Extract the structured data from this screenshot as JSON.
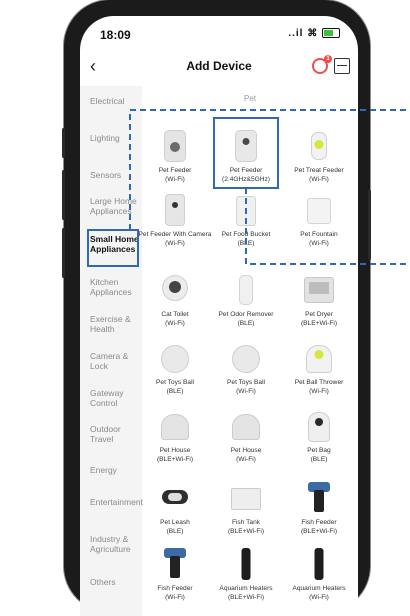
{
  "status": {
    "time": "18:09",
    "signal": "..il"
  },
  "header": {
    "title": "Add Device",
    "badge": "1"
  },
  "section": {
    "label": "Pet"
  },
  "sidebar": {
    "items": [
      {
        "label": "Electrical"
      },
      {
        "label": "Lighting"
      },
      {
        "label": "Sensors"
      },
      {
        "label": "Large Home Appliances"
      },
      {
        "label": "Small Home Appliances"
      },
      {
        "label": "Kitchen Appliances"
      },
      {
        "label": "Exercise & Health"
      },
      {
        "label": "Camera & Lock"
      },
      {
        "label": "Gateway Control"
      },
      {
        "label": "Outdoor Travel"
      },
      {
        "label": "Energy"
      },
      {
        "label": "Entertainment"
      },
      {
        "label": "Industry & Agriculture"
      },
      {
        "label": "Others"
      }
    ]
  },
  "products": [
    {
      "name": "Pet Feeder",
      "sub": "(Wi-Fi)"
    },
    {
      "name": "Pet Feeder",
      "sub": "(2.4GHz&5GHz)"
    },
    {
      "name": "Pet Treat Feeder",
      "sub": "(Wi-Fi)"
    },
    {
      "name": "Pet Feeder With Camera",
      "sub": "(Wi-Fi)"
    },
    {
      "name": "Pet Food Bucket",
      "sub": "(BLE)"
    },
    {
      "name": "Pet Fountain",
      "sub": "(Wi-Fi)"
    },
    {
      "name": "Cat Toilet",
      "sub": "(Wi-Fi)"
    },
    {
      "name": "Pet Odor Remover",
      "sub": "(BLE)"
    },
    {
      "name": "Pet Dryer",
      "sub": "(BLE+Wi-Fi)"
    },
    {
      "name": "Pet Toys Ball",
      "sub": "(BLE)"
    },
    {
      "name": "Pet Toys Ball",
      "sub": "(Wi-Fi)"
    },
    {
      "name": "Pet Ball Thrower",
      "sub": "(Wi-Fi)"
    },
    {
      "name": "Pet House",
      "sub": "(BLE+Wi-Fi)"
    },
    {
      "name": "Pet House",
      "sub": "(Wi-Fi)"
    },
    {
      "name": "Pet Bag",
      "sub": "(BLE)"
    },
    {
      "name": "Pet Leash",
      "sub": "(BLE)"
    },
    {
      "name": "Fish Tank",
      "sub": "(BLE+Wi-Fi)"
    },
    {
      "name": "Fish Feeder",
      "sub": "(BLE+Wi-Fi)"
    },
    {
      "name": "Fish Feeder",
      "sub": "(Wi-Fi)"
    },
    {
      "name": "Aquarium Heaters",
      "sub": "(BLE+Wi-Fi)"
    },
    {
      "name": "Aquarium Heaters",
      "sub": "(Wi-Fi)"
    }
  ],
  "colors": {
    "highlight": "#2f68b4",
    "active_text": "#111111",
    "inactive_text": "#8a8a8a"
  }
}
